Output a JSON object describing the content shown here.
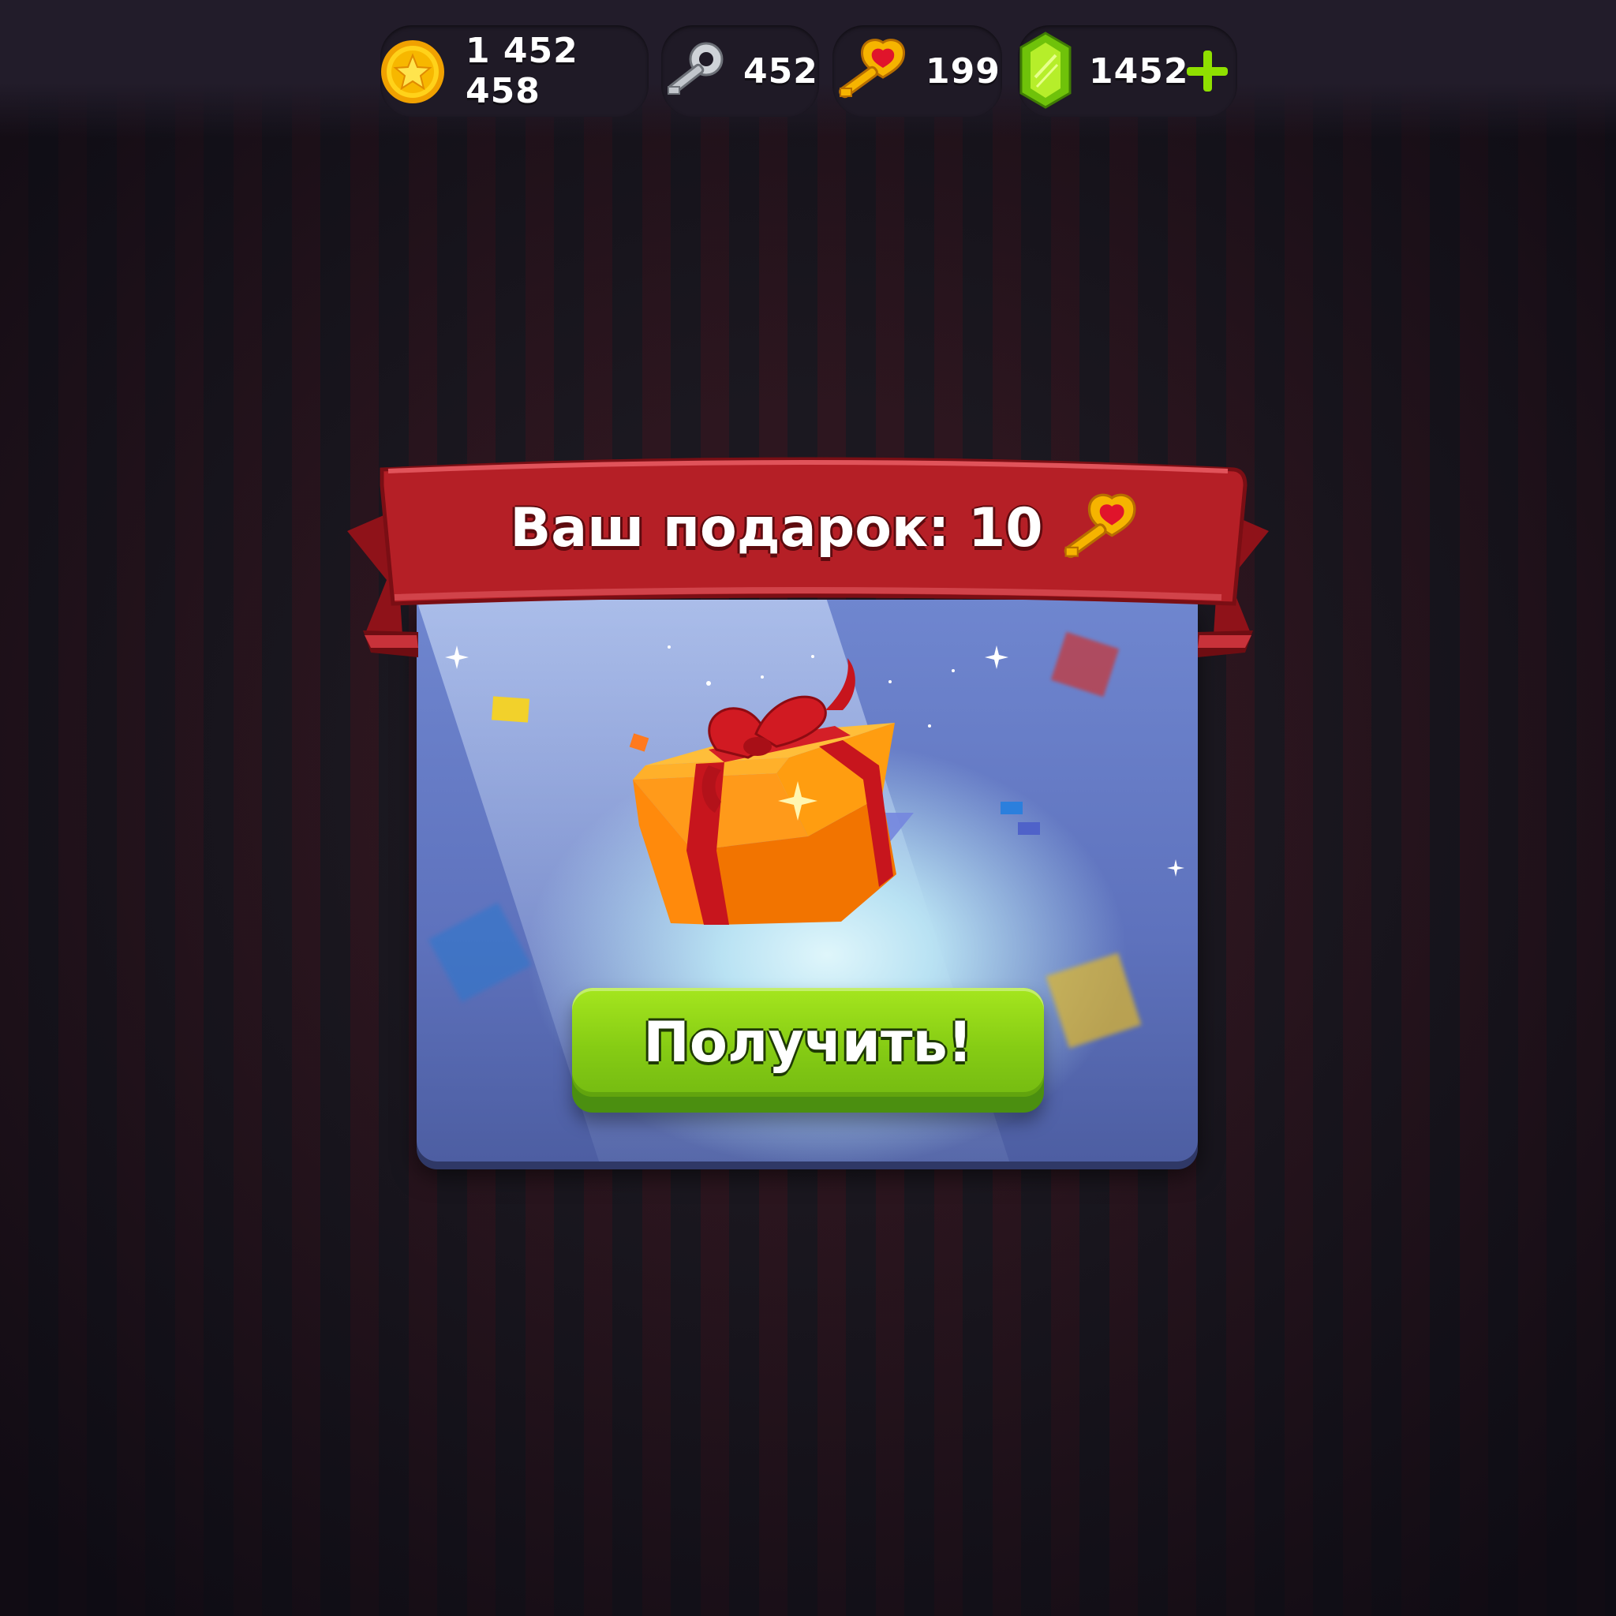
{
  "resources": {
    "coins": "1 452 458",
    "silver_keys": "452",
    "gold_keys": "199",
    "gems": "1452"
  },
  "dialog": {
    "title": "Ваш подарок: 10",
    "reward_icon": "gold-heart-key-icon",
    "claim_label": "Получить!"
  },
  "colors": {
    "ribbon": "#b51f26",
    "button": "#86cc14",
    "panel": "#5e72bd",
    "gift": "#f28a0c",
    "gift_ribbon": "#c0141c"
  }
}
